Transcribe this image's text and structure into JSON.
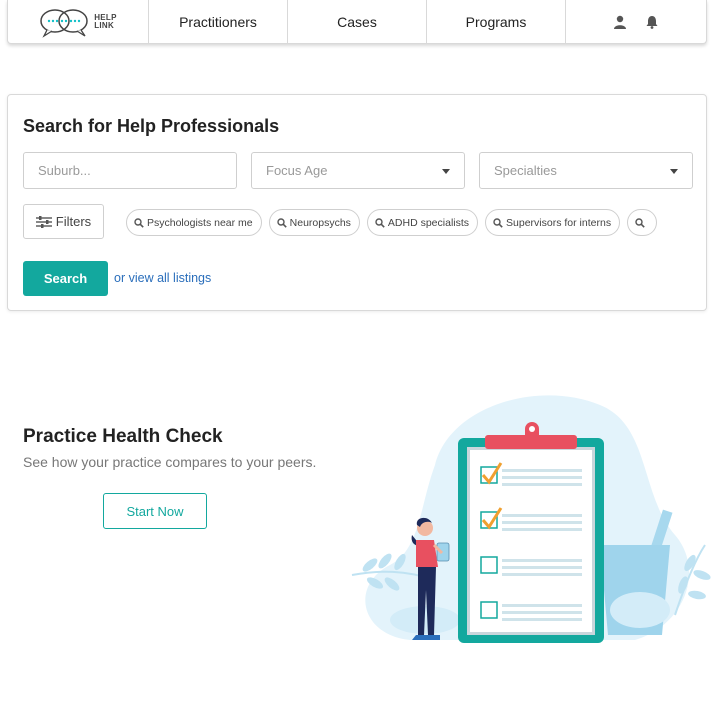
{
  "nav": {
    "logo_line1": "HELP",
    "logo_line2": "LINK",
    "links": [
      "Practitioners",
      "Cases",
      "Programs"
    ],
    "icons": [
      "user-icon",
      "bell-icon"
    ]
  },
  "search": {
    "title": "Search for Help Professionals",
    "suburb_placeholder": "Suburb...",
    "focus_age_label": "Focus Age",
    "specialties_label": "Specialties",
    "filters_label": "Filters",
    "chips": [
      "Psychologists near me",
      "Neuropsychs",
      "ADHD specialists",
      "Supervisors for interns",
      ""
    ],
    "search_button": "Search",
    "view_all_link": "or view all listings"
  },
  "health_check": {
    "title": "Practice Health Check",
    "subtitle": "See how your practice compares to your peers.",
    "button": "Start Now"
  },
  "colors": {
    "accent": "#13a89e",
    "link": "#2a6ebb",
    "checkmark": "#f0a030",
    "clipboard_clip": "#e85060"
  }
}
